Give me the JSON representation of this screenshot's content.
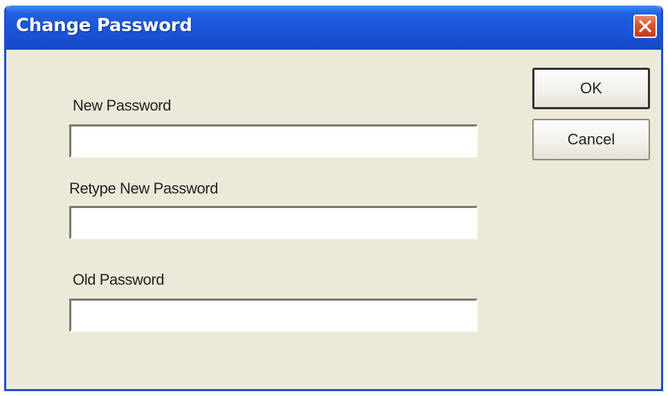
{
  "window": {
    "title": "Change Password"
  },
  "form": {
    "new_password": {
      "label": "New Password",
      "value": ""
    },
    "retype_new_password": {
      "label": "Retype New Password",
      "value": ""
    },
    "old_password": {
      "label": "Old Password",
      "value": ""
    }
  },
  "buttons": {
    "ok_label": "OK",
    "cancel_label": "Cancel"
  },
  "icons": {
    "close": "close-icon"
  },
  "colors": {
    "titlebar": "#1a55d8",
    "dialog_background": "#ece9d8",
    "close_button": "#d9532c"
  }
}
